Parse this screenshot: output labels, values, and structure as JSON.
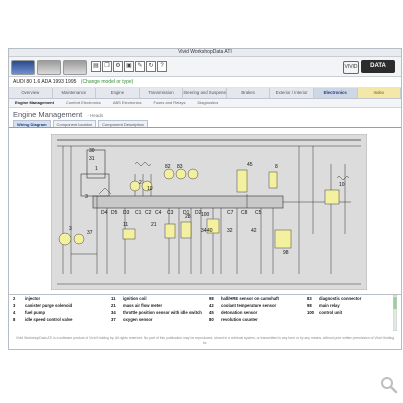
{
  "window": {
    "title": "Vivid WorkshopData ATI"
  },
  "toolbar": {
    "icons": [
      "print-icon",
      "copy-icon",
      "settings-icon",
      "image-icon",
      "tools-icon",
      "refresh-icon",
      "help-icon"
    ],
    "logo_text": "DATA",
    "logo_badge": "VIVID"
  },
  "vehicle": {
    "name": "AUDI 80   1.6 ADA 1993 1995",
    "change_label": "(Change model or type)"
  },
  "tabs": [
    {
      "label": "Overview"
    },
    {
      "label": "Maintenance"
    },
    {
      "label": "Engine"
    },
    {
      "label": "Transmission"
    },
    {
      "label": "Steering and Suspension"
    },
    {
      "label": "Brakes"
    },
    {
      "label": "Exterior / Interior"
    },
    {
      "label": "Electronics"
    },
    {
      "label": "Index"
    }
  ],
  "active_tab": "Electronics",
  "subtabs": [
    {
      "label": "Engine Management"
    },
    {
      "label": "Comfort Electronics"
    },
    {
      "label": "ABS Electronics"
    },
    {
      "label": "Fuses and Relays"
    },
    {
      "label": "Diagnostics"
    }
  ],
  "section": {
    "title": "Engine Management",
    "crumb": "- Heads"
  },
  "doc_tabs": [
    {
      "label": "Wiring Diagram"
    },
    {
      "label": "Component location"
    },
    {
      "label": "Component Description"
    }
  ],
  "diagram": {
    "labels": [
      "30",
      "31",
      "1",
      "2",
      "3",
      "11",
      "21",
      "37",
      "82",
      "83",
      "45",
      "8",
      "100",
      "34",
      "28",
      "40",
      "32",
      "42",
      "98",
      "10",
      "3",
      "10",
      "D4",
      "D5",
      "D3",
      "C1",
      "C2",
      "C4",
      "C3",
      "D1",
      "D2",
      "C7",
      "C8",
      "C5"
    ]
  },
  "legend": [
    {
      "num": "2",
      "text": "injector"
    },
    {
      "num": "11",
      "text": "ignition coil"
    },
    {
      "num": "98",
      "text": "hall/HRE sensor on camshaft"
    },
    {
      "num": "83",
      "text": "diagnostic connector"
    },
    {
      "num": "3",
      "text": "canister purge solenoid"
    },
    {
      "num": "21",
      "text": "mass air flow meter"
    },
    {
      "num": "42",
      "text": "coolant temperature sensor"
    },
    {
      "num": "98",
      "text": "main relay"
    },
    {
      "num": "4",
      "text": "fuel pump"
    },
    {
      "num": "34",
      "text": "throttle position sensor with idle switch"
    },
    {
      "num": "45",
      "text": "detonation sensor"
    },
    {
      "num": "100",
      "text": "control unit"
    },
    {
      "num": "8",
      "text": "idle speed control valve"
    },
    {
      "num": "37",
      "text": "oxygen sensor"
    },
    {
      "num": "80",
      "text": "revolution counter"
    },
    {
      "num": "",
      "text": ""
    }
  ],
  "footer_note": "Vivid WorkshopData ATI is a software product of Vivid Holding by. All rights reserved. No part of this publication may be reproduced, stored in a retrieval system, or transmitted in any form or by any means, without prior written permission of Vivid Holding bv.",
  "colors": {
    "accent": "#1e3f7a",
    "index_tab": "#f4e8a8",
    "diagram_bg": "#dcdcdc",
    "highlight": "#f3f0a0"
  }
}
